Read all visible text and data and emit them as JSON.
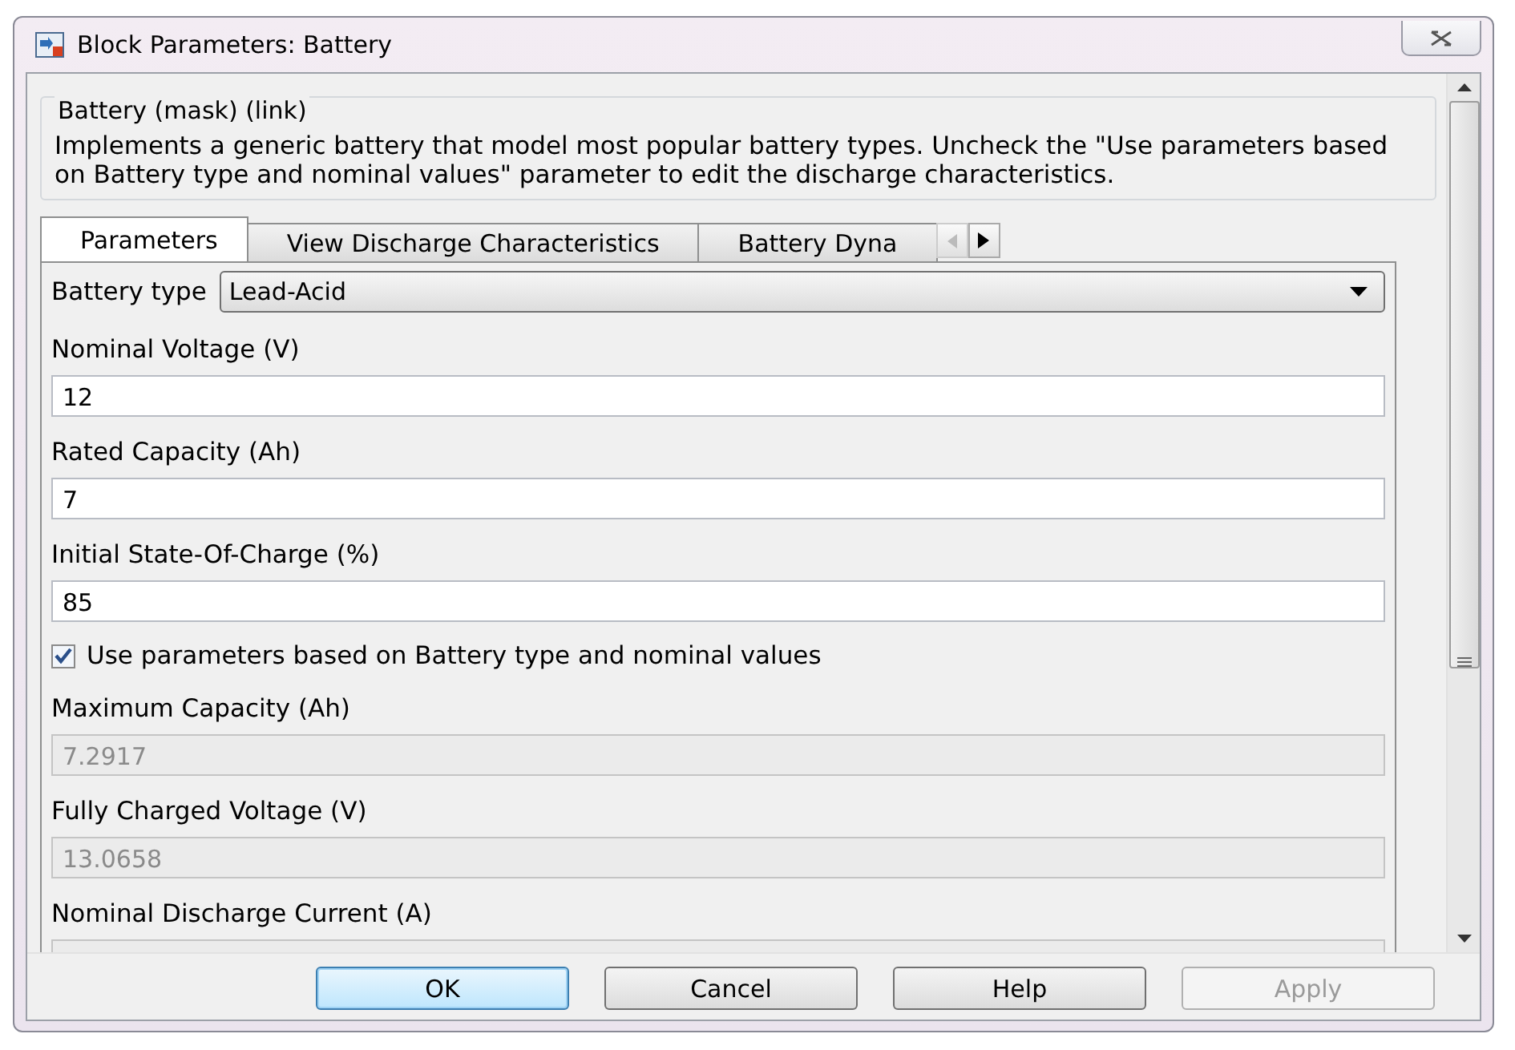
{
  "window": {
    "title": "Block Parameters: Battery"
  },
  "description": {
    "title": "Battery (mask) (link)",
    "text": "Implements a generic battery that model most popular battery types. Uncheck the \"Use parameters based on Battery type and nominal values\" parameter to edit the discharge characteristics."
  },
  "tabs": [
    {
      "label": "Parameters",
      "selected": true
    },
    {
      "label": "View Discharge Characteristics",
      "selected": false
    },
    {
      "label": "Battery Dyna",
      "selected": false
    }
  ],
  "battery_type": {
    "label": "Battery type",
    "value": "Lead-Acid"
  },
  "parameters": [
    {
      "kind": "field",
      "label": "Nominal Voltage (V)",
      "value": "12",
      "disabled": false
    },
    {
      "kind": "field",
      "label": "Rated Capacity (Ah)",
      "value": "7",
      "disabled": false
    },
    {
      "kind": "field",
      "label": "Initial State-Of-Charge (%)",
      "value": "85",
      "disabled": false
    },
    {
      "kind": "checkbox",
      "label": "Use parameters based on Battery type and nominal values",
      "checked": true
    },
    {
      "kind": "field",
      "label": "Maximum Capacity (Ah)",
      "value": "7.2917",
      "disabled": true
    },
    {
      "kind": "field",
      "label": "Fully Charged Voltage (V)",
      "value": "13.0658",
      "disabled": true
    },
    {
      "kind": "field",
      "label": "Nominal Discharge Current (A)",
      "disabled": true
    }
  ],
  "buttons": [
    {
      "label": "OK",
      "default": true,
      "disabled": false
    },
    {
      "label": "Cancel",
      "default": false,
      "disabled": false
    },
    {
      "label": "Help",
      "default": false,
      "disabled": false
    },
    {
      "label": "Apply",
      "default": false,
      "disabled": true
    }
  ]
}
